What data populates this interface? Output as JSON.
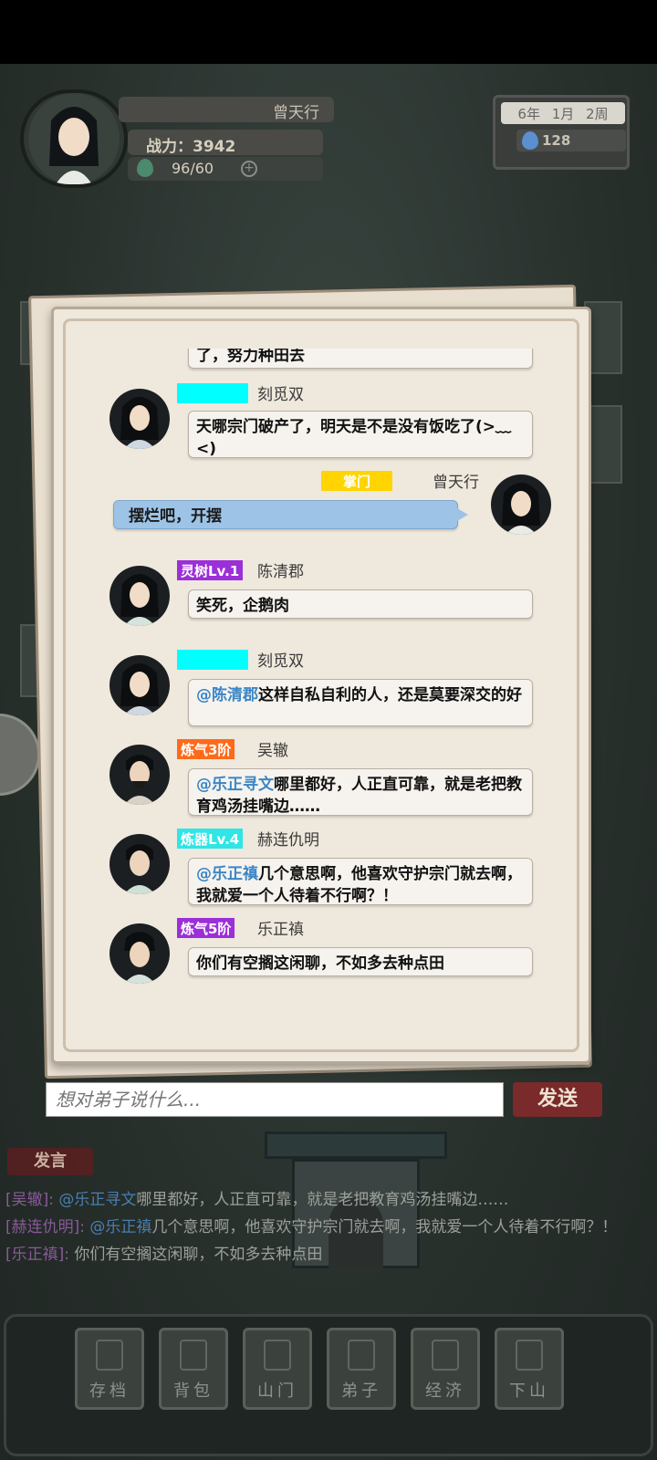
{
  "player": {
    "name": "曾天行",
    "power_label": "战力：3942",
    "stamina": "96/60"
  },
  "calendar": {
    "date": "6年 1月 2周",
    "spirit_stones": "128"
  },
  "chat": {
    "partial_message": "了，努力种田去",
    "messages": [
      {
        "name": "刻觅双",
        "badge": "",
        "badge_color": "#00ffff",
        "text": "天哪宗门破产了，明天是不是没有饭吃了(>﹏<)",
        "mention": ""
      },
      {
        "name": "曾天行",
        "badge": "掌门",
        "badge_color": "#ffd400",
        "text": "摆烂吧，开摆",
        "mention": "",
        "self": true
      },
      {
        "name": "陈清郡",
        "badge": "灵树Lv.1",
        "badge_color": "#9b2fd8",
        "text": "笑死，企鹅肉",
        "mention": ""
      },
      {
        "name": "刻觅双",
        "badge": "",
        "badge_color": "#00ffff",
        "text": "这样自私自利的人，还是莫要深交的好",
        "mention": "@陈清郡"
      },
      {
        "name": "吴辙",
        "badge": "炼气3阶",
        "badge_color": "#ff6a1a",
        "text": "哪里都好，人正直可靠，就是老把教育鸡汤挂嘴边……",
        "mention": "@乐正寻文"
      },
      {
        "name": "赫连仇明",
        "badge": "炼器Lv.4",
        "badge_color": "#2ee6e6",
        "text": "几个意思啊，他喜欢守护宗门就去啊，我就爱一个人待着不行啊？！",
        "mention": "@乐正禛"
      },
      {
        "name": "乐正禛",
        "badge": "炼气5阶",
        "badge_color": "#9b2fd8",
        "text": "你们有空搁这闲聊，不如多去种点田",
        "mention": ""
      }
    ],
    "input_placeholder": "想对弟子说什么...",
    "send_label": "发送"
  },
  "background_log": {
    "speak_tab": "发言",
    "lines": [
      {
        "name": "[吴辙]:",
        "mention": "@乐正寻文",
        "text": "哪里都好，人正直可靠，就是老把教育鸡汤挂嘴边……"
      },
      {
        "name": "[赫连仇明]:",
        "mention": "@乐正禛",
        "text": "几个意思啊，他喜欢守护宗门就去啊，我就爱一个人待着不行啊？！"
      },
      {
        "name": "[乐正禛]:",
        "mention": "",
        "text": "你们有空搁这闲聊，不如多去种点田"
      }
    ]
  },
  "bottom_nav": [
    "存档",
    "背包",
    "山门",
    "弟子",
    "经济",
    "下山"
  ]
}
